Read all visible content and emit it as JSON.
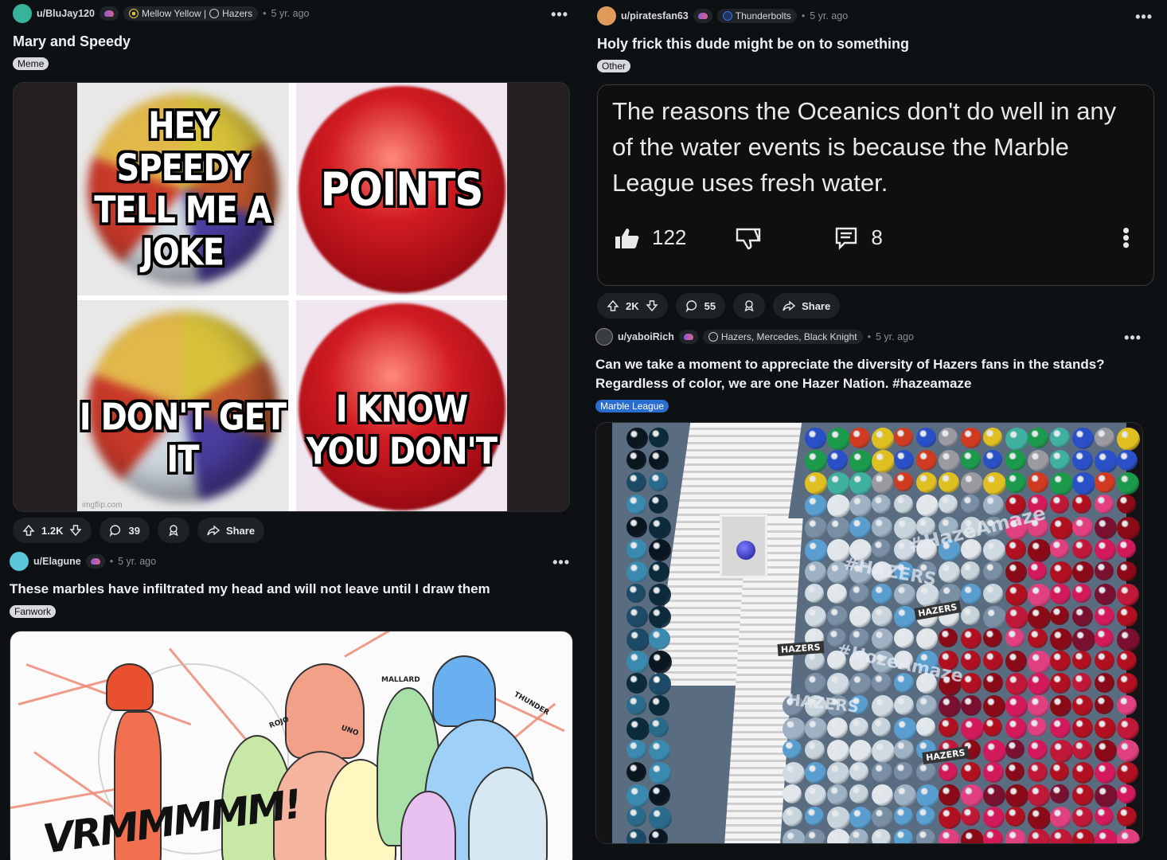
{
  "posts": [
    {
      "author": "u/BluJay120",
      "flair_user": "Mellow Yellow | ",
      "flair_user2": "Hazers",
      "time": "5 yr. ago",
      "title": "Mary and Speedy",
      "tag": "Meme",
      "meme": {
        "tl": "HEY SPEEDY TELL ME A JOKE",
        "tr": "POINTS",
        "bl": "I DON'T GET IT",
        "br": "I KNOW YOU DON'T",
        "watermark": "imgflip.com"
      },
      "upvotes": "1.2K",
      "comments": "39",
      "share": "Share"
    },
    {
      "author": "u/piratesfan63",
      "flair_user": "Thunderbolts",
      "time": "5 yr. ago",
      "title": "Holy frick this dude might be on to something",
      "tag": "Other",
      "comment_shot": {
        "text": "The reasons the Oceanics don't do well in any of the water events is because the Marble League uses fresh water.",
        "likes": "122",
        "replies": "8"
      },
      "upvotes": "2K",
      "comments": "55",
      "share": "Share"
    },
    {
      "author": "u/Elagune",
      "time": "5 yr. ago",
      "title": "These marbles have infiltrated my head and will not leave until I draw them",
      "tag": "Fanwork",
      "art_labels": [
        "ROJO",
        "UNO",
        "MALLARD",
        "THUNDER"
      ],
      "art_text": "VRMMMMM!"
    },
    {
      "author": "u/yaboiRich",
      "flair_user": "Hazers, Mercedes, Black Knight",
      "time": "5 yr. ago",
      "title": "Can we take a moment to appreciate the diversity of Hazers fans in the stands? Regardless of color, we are one Hazer Nation. #hazeamaze",
      "tag": "Marble League",
      "signs": [
        "#HazeAmaze",
        "#HAZERS",
        "HAZERS",
        "#HozeAmaze",
        "HAZERS",
        "HAZERS",
        "HAZERS"
      ]
    }
  ],
  "icons": {
    "upvote": "arrow-up-icon",
    "downvote": "arrow-down-icon",
    "comment": "speech-bubble-icon",
    "award": "award-icon",
    "share": "share-arrow-icon",
    "more": "ellipsis-icon"
  },
  "colors": {
    "background": "#0e1113",
    "pill": "#1e2225",
    "tag_blue": "#2a6dd0"
  }
}
